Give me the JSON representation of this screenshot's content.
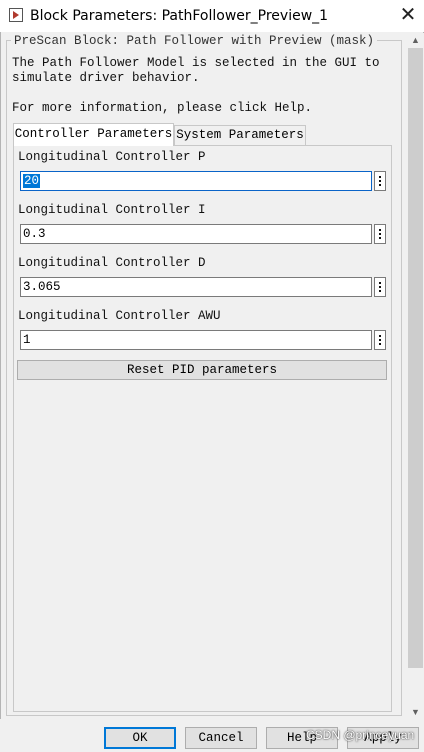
{
  "window": {
    "title": "Block Parameters: PathFollower_Preview_1",
    "icon": "simulink-block-icon",
    "close_symbol": "✕"
  },
  "group": {
    "title": "PreScan Block: Path Follower with Preview (mask)",
    "description": "The Path Follower Model is selected in the GUI to simulate driver behavior.",
    "help_line": "For more information, please click Help."
  },
  "tabs": [
    {
      "label": "Controller Parameters",
      "active": true
    },
    {
      "label": "System Parameters",
      "active": false
    }
  ],
  "params": [
    {
      "label": "Longitudinal Controller P",
      "value": "20"
    },
    {
      "label": "Longitudinal Controller I",
      "value": "0.3"
    },
    {
      "label": "Longitudinal Controller D",
      "value": "3.065"
    },
    {
      "label": "Longitudinal Controller AWU",
      "value": "1"
    }
  ],
  "reset_button": {
    "label": "Reset PID parameters"
  },
  "buttons": {
    "ok": "OK",
    "cancel": "Cancel",
    "help": "Help",
    "apply": "Apply"
  },
  "watermark": "CSDN @princeyuan",
  "colors": {
    "selection": "#0078d7",
    "focus_border": "#0a64c8",
    "window_bg": "#f0f0f0"
  }
}
